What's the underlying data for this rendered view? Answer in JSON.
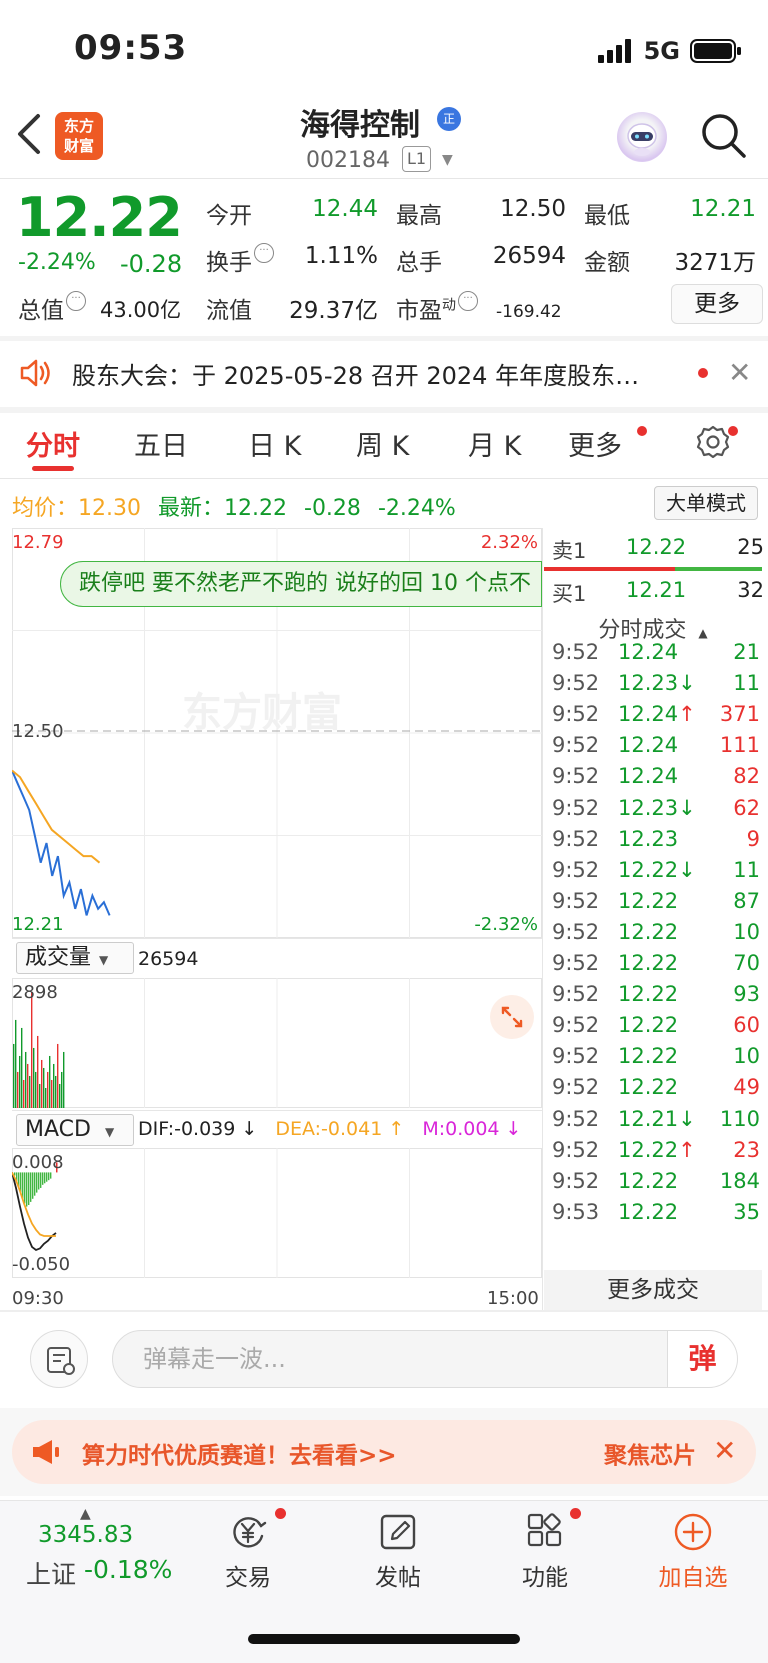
{
  "status_bar": {
    "time": "09:53",
    "network": "5G"
  },
  "header": {
    "logo_text_1": "东方",
    "logo_text_2": "财富",
    "stock_name": "海得控制",
    "verified_badge": "正",
    "stock_code": "002184",
    "level_badge": "L1"
  },
  "quote": {
    "price": "12.22",
    "change_pct": "-2.24%",
    "change_abs": "-0.28",
    "fields": [
      {
        "label": "今开",
        "value": "12.44",
        "color": "#119a2b"
      },
      {
        "label": "最高",
        "value": "12.50",
        "color": "#222222"
      },
      {
        "label": "最低",
        "value": "12.21",
        "color": "#119a2b"
      },
      {
        "label": "换手",
        "value": "1.11%",
        "color": "#222222"
      },
      {
        "label": "总手",
        "value": "26594",
        "color": "#222222"
      },
      {
        "label": "金额",
        "value": "3271万",
        "color": "#222222"
      },
      {
        "label": "总值",
        "value": "43.00亿",
        "color": "#222222"
      },
      {
        "label": "流值",
        "value": "29.37亿",
        "color": "#222222"
      },
      {
        "label": "市盈",
        "value": "-169.42",
        "color": "#222222"
      }
    ],
    "pe_superscript": "动",
    "more_label": "更多"
  },
  "announcement": {
    "text": "股东大会：于 2025-05-28 召开 2024 年年度股东…"
  },
  "tabs": {
    "items": [
      "分时",
      "五日",
      "日 K",
      "周 K",
      "月 K",
      "更多"
    ],
    "active": "分时"
  },
  "avg_row": {
    "avg_label": "均价：",
    "avg_value": "12.30",
    "latest_label": "最新：",
    "latest_value": "12.22",
    "latest_change": "-0.28",
    "latest_pct": "-2.24%",
    "big_order_mode": "大单模式"
  },
  "chart_data": {
    "type": "line",
    "title": "",
    "xlabel": "",
    "ylabel": "",
    "x_range": [
      "09:30",
      "15:00"
    ],
    "ylim": [
      12.21,
      12.79
    ],
    "axis_labels": {
      "y_top": "12.79",
      "y_mid": "12.50",
      "y_bottom": "12.21",
      "pct_top": "2.32%",
      "pct_bottom": "-2.32%"
    },
    "series": [
      {
        "name": "",
        "color": "#2a6fd6",
        "values": [
          12.44,
          12.42,
          12.4,
          12.38,
          12.34,
          12.3,
          12.33,
          12.28,
          12.31,
          12.25,
          12.27,
          12.23,
          12.26,
          12.22,
          12.25,
          12.23,
          12.24,
          12.22
        ]
      },
      {
        "name": "",
        "color": "#f5a623",
        "values": [
          12.44,
          12.43,
          12.41,
          12.39,
          12.37,
          12.35,
          12.34,
          12.33,
          12.32,
          12.31,
          12.31,
          12.3
        ]
      }
    ],
    "volume": {
      "dropdown_label": "成交量",
      "total": "26594",
      "max_label": "2898",
      "bars": [
        1600,
        2200,
        900,
        1300,
        2000,
        700,
        1400,
        1100,
        800,
        2898,
        1500,
        900,
        1800,
        600,
        1200,
        1000,
        500,
        900,
        1300,
        700,
        1100,
        800,
        1600,
        600,
        900,
        1400
      ],
      "bar_colors": [
        "#119a2b",
        "#119a2b",
        "#e8312f",
        "#119a2b",
        "#119a2b",
        "#e8312f",
        "#119a2b",
        "#e8312f",
        "#119a2b",
        "#e8312f",
        "#119a2b",
        "#119a2b",
        "#e8312f",
        "#119a2b",
        "#e8312f",
        "#119a2b",
        "#119a2b",
        "#e8312f",
        "#119a2b",
        "#e8312f",
        "#119a2b",
        "#119a2b",
        "#e8312f",
        "#119a2b",
        "#119a2b",
        "#119a2b"
      ]
    },
    "macd": {
      "dropdown_label": "MACD",
      "dif": "DIF:-0.039 ↓",
      "dea": "DEA:-0.041 ↑",
      "m": "M:0.004 ↓",
      "y_top": "0.008",
      "y_bottom": "-0.050",
      "ylim": [
        -0.05,
        0.008
      ]
    },
    "time_start": "09:30",
    "time_end": "15:00"
  },
  "danmu_overlay": "跌停吧 要不然老严不跑的 说好的回 10 个点不",
  "watermark": "东方财富",
  "order_book": {
    "sell": {
      "label": "卖1",
      "price": "12.22",
      "volume": "25"
    },
    "buy": {
      "label": "买1",
      "price": "12.21",
      "volume": "32"
    }
  },
  "ticks": {
    "header": "分时成交",
    "rows": [
      {
        "time": "9:52",
        "price": "12.24",
        "arrow": "",
        "volume": "21",
        "price_color": "#119a2b",
        "vol_color": "#119a2b"
      },
      {
        "time": "9:52",
        "price": "12.23",
        "arrow": "↓",
        "volume": "11",
        "price_color": "#119a2b",
        "vol_color": "#119a2b"
      },
      {
        "time": "9:52",
        "price": "12.24",
        "arrow": "↑",
        "volume": "371",
        "price_color": "#119a2b",
        "vol_color": "#e8312f"
      },
      {
        "time": "9:52",
        "price": "12.24",
        "arrow": "",
        "volume": "111",
        "price_color": "#119a2b",
        "vol_color": "#e8312f"
      },
      {
        "time": "9:52",
        "price": "12.24",
        "arrow": "",
        "volume": "82",
        "price_color": "#119a2b",
        "vol_color": "#e8312f"
      },
      {
        "time": "9:52",
        "price": "12.23",
        "arrow": "↓",
        "volume": "62",
        "price_color": "#119a2b",
        "vol_color": "#e8312f"
      },
      {
        "time": "9:52",
        "price": "12.23",
        "arrow": "",
        "volume": "9",
        "price_color": "#119a2b",
        "vol_color": "#e8312f"
      },
      {
        "time": "9:52",
        "price": "12.22",
        "arrow": "↓",
        "volume": "11",
        "price_color": "#119a2b",
        "vol_color": "#119a2b"
      },
      {
        "time": "9:52",
        "price": "12.22",
        "arrow": "",
        "volume": "87",
        "price_color": "#119a2b",
        "vol_color": "#119a2b"
      },
      {
        "time": "9:52",
        "price": "12.22",
        "arrow": "",
        "volume": "10",
        "price_color": "#119a2b",
        "vol_color": "#119a2b"
      },
      {
        "time": "9:52",
        "price": "12.22",
        "arrow": "",
        "volume": "70",
        "price_color": "#119a2b",
        "vol_color": "#119a2b"
      },
      {
        "time": "9:52",
        "price": "12.22",
        "arrow": "",
        "volume": "93",
        "price_color": "#119a2b",
        "vol_color": "#119a2b"
      },
      {
        "time": "9:52",
        "price": "12.22",
        "arrow": "",
        "volume": "60",
        "price_color": "#119a2b",
        "vol_color": "#e8312f"
      },
      {
        "time": "9:52",
        "price": "12.22",
        "arrow": "",
        "volume": "10",
        "price_color": "#119a2b",
        "vol_color": "#119a2b"
      },
      {
        "time": "9:52",
        "price": "12.22",
        "arrow": "",
        "volume": "49",
        "price_color": "#119a2b",
        "vol_color": "#e8312f"
      },
      {
        "time": "9:52",
        "price": "12.21",
        "arrow": "↓",
        "volume": "110",
        "price_color": "#119a2b",
        "vol_color": "#119a2b"
      },
      {
        "time": "9:52",
        "price": "12.22",
        "arrow": "↑",
        "volume": "23",
        "price_color": "#119a2b",
        "vol_color": "#e8312f"
      },
      {
        "time": "9:52",
        "price": "12.22",
        "arrow": "",
        "volume": "184",
        "price_color": "#119a2b",
        "vol_color": "#119a2b"
      },
      {
        "time": "9:53",
        "price": "12.22",
        "arrow": "",
        "volume": "35",
        "price_color": "#119a2b",
        "vol_color": "#119a2b"
      }
    ],
    "more_label": "更多成交"
  },
  "danmu_input": {
    "placeholder": "弹幕走一波...",
    "send_label": "弹"
  },
  "promo": {
    "text": "算力时代优质赛道！去看看>>",
    "text2": "聚焦芯片"
  },
  "bottom_nav": {
    "index_value": "3345.83",
    "index_name": "上证",
    "index_change": "-0.18%",
    "items": [
      {
        "label": "交易",
        "icon": "yuan-exchange-icon"
      },
      {
        "label": "发帖",
        "icon": "edit-post-icon"
      },
      {
        "label": "功能",
        "icon": "grid-apps-icon"
      },
      {
        "label": "加自选",
        "icon": "add-circle-icon"
      }
    ]
  },
  "colors": {
    "up": "#e8312f",
    "down": "#119a2b",
    "avg": "#f5a623",
    "price_line": "#2a6fd6",
    "accent": "#ee5a24"
  }
}
